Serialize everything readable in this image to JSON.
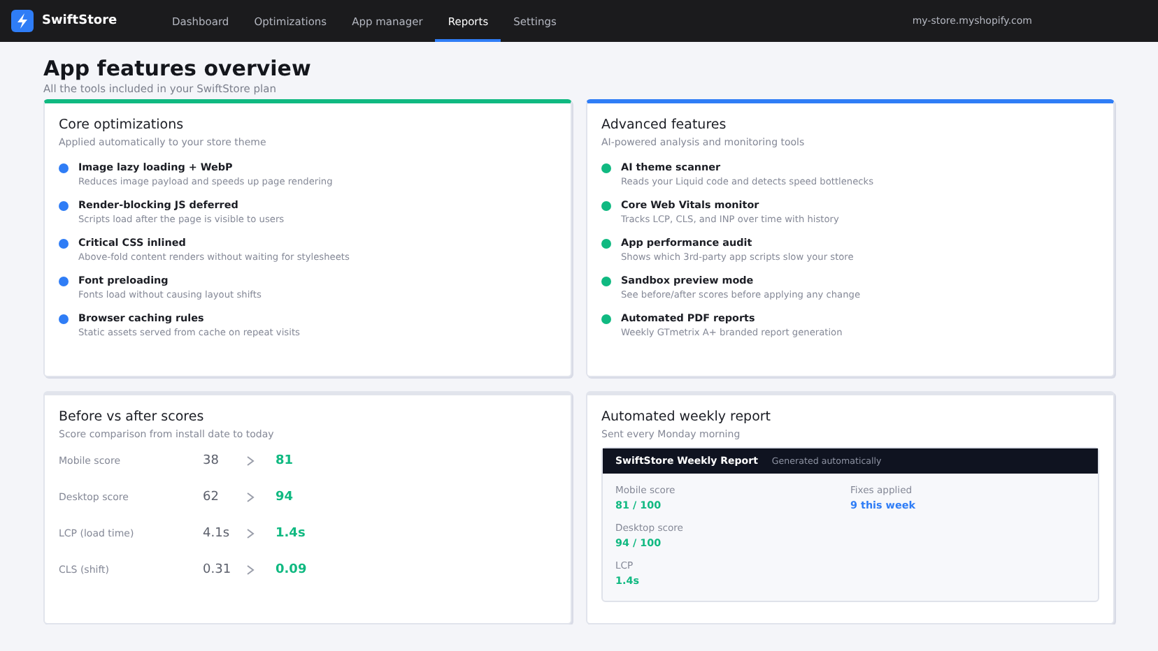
{
  "brand": {
    "name": "SwiftStore"
  },
  "nav": [
    {
      "label": "Dashboard",
      "selected": false
    },
    {
      "label": "Optimizations",
      "selected": false
    },
    {
      "label": "App manager",
      "selected": false
    },
    {
      "label": "Reports",
      "selected": true
    },
    {
      "label": "Settings",
      "selected": false
    }
  ],
  "store_url": "my-store.myshopify.com",
  "page": {
    "title": "App features overview",
    "subtitle": "All the tools included in your SwiftStore plan"
  },
  "feature_cards": [
    {
      "title": "Core optimizations",
      "subtitle": "Applied automatically to your store theme",
      "color": "#10b981",
      "items": [
        {
          "title": "Image lazy loading + WebP",
          "description": "Reduces image payload and speeds up page rendering",
          "color": "#2f7df6"
        },
        {
          "title": "Render-blocking JS deferred",
          "description": "Scripts load after the page is visible to users",
          "color": "#2f7df6"
        },
        {
          "title": "Critical CSS inlined",
          "description": "Above-fold content renders without waiting for stylesheets",
          "color": "#2f7df6"
        },
        {
          "title": "Font preloading",
          "description": "Fonts load without causing layout shifts",
          "color": "#2f7df6"
        },
        {
          "title": "Browser caching rules",
          "description": "Static assets served from cache on repeat visits",
          "color": "#2f7df6"
        }
      ]
    },
    {
      "title": "Advanced features",
      "subtitle": "AI-powered analysis and monitoring tools",
      "color": "#2f7df6",
      "items": [
        {
          "title": "AI theme scanner",
          "description": "Reads your Liquid code and detects speed bottlenecks",
          "color": "#10b981"
        },
        {
          "title": "Core Web Vitals monitor",
          "description": "Tracks LCP, CLS, and INP over time with history",
          "color": "#10b981"
        },
        {
          "title": "App performance audit",
          "description": "Shows which 3rd-party app scripts slow your store",
          "color": "#10b981"
        },
        {
          "title": "Sandbox preview mode",
          "description": "See before/after scores before applying any change",
          "color": "#10b981"
        },
        {
          "title": "Automated PDF reports",
          "description": "Weekly GTmetrix A+ branded report generation",
          "color": "#10b981"
        }
      ]
    }
  ],
  "scores": {
    "title": "Before vs after scores",
    "subtitle": "Score comparison from install date to today",
    "rows": [
      {
        "label": "Mobile score",
        "before": "38",
        "after": "81"
      },
      {
        "label": "Desktop score",
        "before": "62",
        "after": "94"
      },
      {
        "label": "LCP (load time)",
        "before": "4.1s",
        "after": "1.4s"
      },
      {
        "label": "CLS (shift)",
        "before": "0.31",
        "after": "0.09"
      }
    ]
  },
  "weekly_report": {
    "title": "Automated weekly report",
    "subtitle": "Sent every Monday morning",
    "report_title": "SwiftStore Weekly Report",
    "report_note": "Generated automatically",
    "metrics": [
      {
        "label": "Mobile score",
        "value": "81 / 100",
        "color": "#10b981"
      },
      {
        "label": "Desktop score",
        "value": "94 / 100",
        "color": "#10b981"
      },
      {
        "label": "LCP",
        "value": "1.4s",
        "color": "#10b981"
      },
      {
        "label": "Fixes applied",
        "value": "9 this week",
        "color": "#2f7df6"
      }
    ]
  }
}
